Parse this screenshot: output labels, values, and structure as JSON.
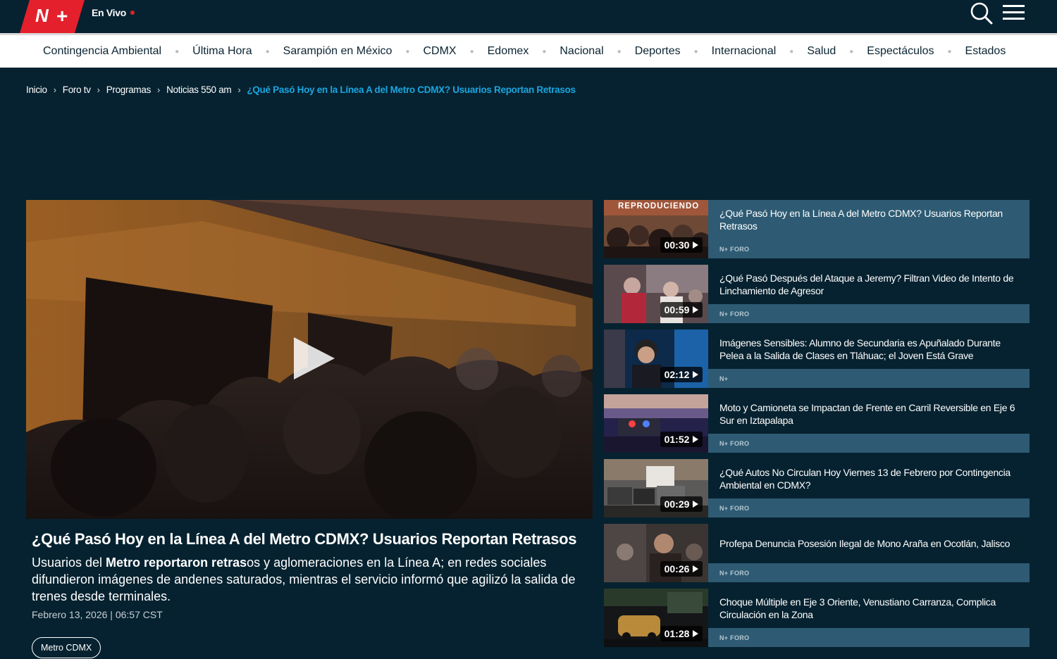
{
  "header": {
    "live_label": "En Vivo",
    "brand_color": "#e3202b"
  },
  "nav": {
    "items": [
      "Contingencia Ambiental",
      "Última Hora",
      "Sarampión en México",
      "CDMX",
      "Edomex",
      "Nacional",
      "Deportes",
      "Internacional",
      "Salud",
      "Espectáculos",
      "Estados"
    ]
  },
  "breadcrumb": {
    "items": [
      "Inicio",
      "Foro tv",
      "Programas",
      "Noticias 550 am"
    ],
    "current": "¿Qué Pasó Hoy en la Línea A del Metro CDMX? Usuarios Reportan Retrasos"
  },
  "article": {
    "title": "¿Qué Pasó Hoy en la Línea A del Metro CDMX? Usuarios Reportan Retrasos",
    "desc_bold": "Metro reportaron retras",
    "desc_before": "Usuarios del ",
    "desc_after": "os y aglomeraciones en la Línea A; en redes sociales difundieron imágenes de andenes saturados, mientras el servicio informó que agilizó la salida de trenes desde terminales.",
    "date": "Febrero 13, 2026 | 06:57 CST",
    "tag": "Metro CDMX"
  },
  "playlist": {
    "now_playing_label": "REPRODUCIENDO",
    "items": [
      {
        "title": "¿Qué Pasó Hoy en la Línea A del Metro CDMX? Usuarios Reportan Retrasos",
        "duration": "00:30",
        "source": "N+ FORO"
      },
      {
        "title": "¿Qué Pasó Después del Ataque a Jeremy? Filtran Video de Intento de Linchamiento de Agresor",
        "duration": "00:59",
        "source": "N+ FORO"
      },
      {
        "title": "Imágenes Sensibles: Alumno de Secundaria es Apuñalado Durante Pelea a la Salida de Clases en Tláhuac; el Joven Está Grave",
        "duration": "02:12",
        "source": "N+"
      },
      {
        "title": "Moto y Camioneta se Impactan de Frente en Carril Reversible en Eje 6 Sur en Iztapalapa",
        "duration": "01:52",
        "source": "N+ FORO"
      },
      {
        "title": "¿Qué Autos No Circulan Hoy Viernes 13 de Febrero por Contingencia Ambiental en CDMX?",
        "duration": "00:29",
        "source": "N+ FORO"
      },
      {
        "title": "Profepa Denuncia Posesión Ilegal de Mono Araña en Ocotlán, Jalisco",
        "duration": "00:26",
        "source": "N+ FORO"
      },
      {
        "title": "Choque Múltiple en Eje 3 Oriente, Venustiano Carranza, Complica Circulación en la Zona",
        "duration": "01:28",
        "source": "N+ FORO"
      }
    ]
  }
}
